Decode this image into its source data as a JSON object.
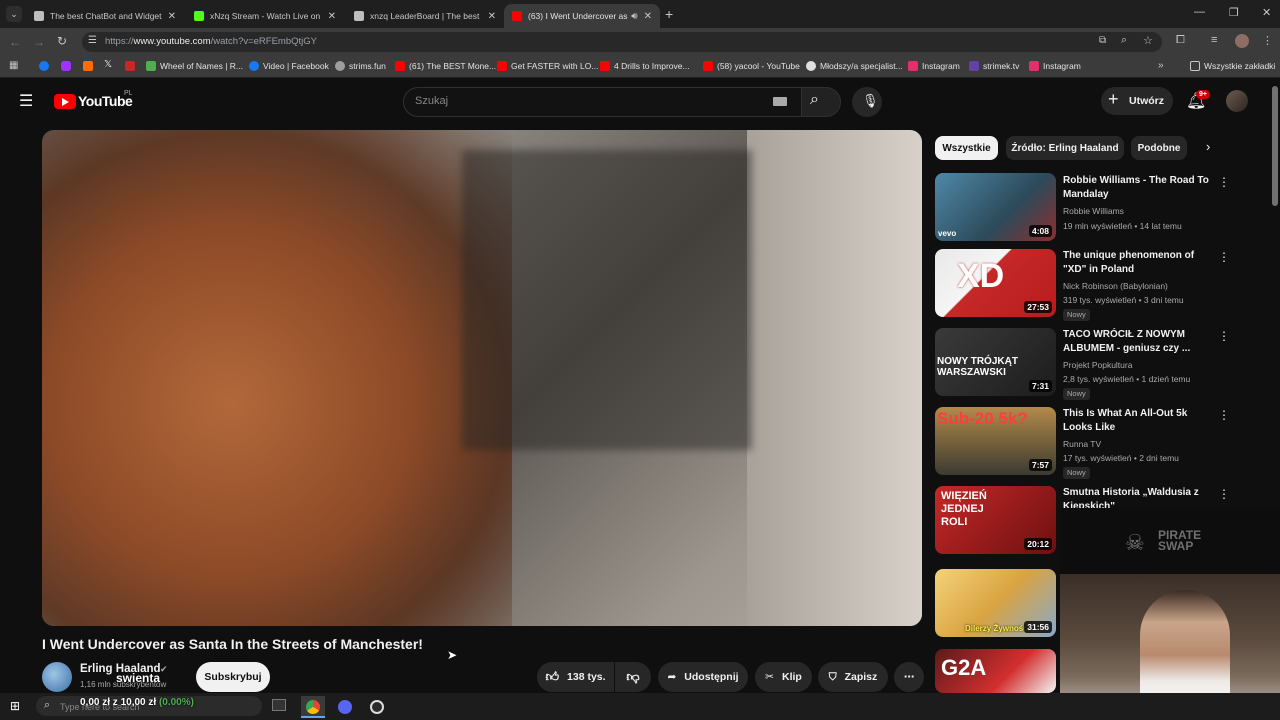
{
  "browser": {
    "tabs": [
      {
        "title": "The best ChatBot and Widgets",
        "active": false,
        "favicon_color": "#bdbdbd"
      },
      {
        "title": "xNzq Stream - Watch Live on K",
        "active": false,
        "favicon_color": "#53fc18"
      },
      {
        "title": "xnzq LeaderBoard | The best Ch",
        "active": false,
        "favicon_color": "#bdbdbd"
      },
      {
        "title": "(63) I Went Undercover as S",
        "active": true,
        "favicon_color": "#ff0000"
      }
    ],
    "url_prefix": "https://",
    "url_host": "www.youtube.com",
    "url_path": "/watch?v=eRFEmbQtjGY",
    "bookmarks": [
      {
        "label": "Wheel of Names | R...",
        "color": "#4caf50"
      },
      {
        "label": "Video | Facebook",
        "color": "#1877f2"
      },
      {
        "label": "strims.fun",
        "color": "#9e9e9e"
      },
      {
        "label": "(61) The BEST Mone...",
        "color": "#ff0000"
      },
      {
        "label": "Get FASTER with LO...",
        "color": "#ff0000"
      },
      {
        "label": "4 Drills to Improve...",
        "color": "#ff0000"
      },
      {
        "label": "(58) yacool - YouTube",
        "color": "#ff0000"
      },
      {
        "label": "Młodszy/a specjalist...",
        "color": "#e0e0e0"
      },
      {
        "label": "Instagram",
        "color": "#e1306c"
      },
      {
        "label": "strimek.tv",
        "color": "#6441a5"
      },
      {
        "label": "Instagram",
        "color": "#e1306c"
      }
    ],
    "all_bookmarks_label": "Wszystkie zakładki"
  },
  "youtube": {
    "logo_text": "YouTube",
    "region": "PL",
    "search_placeholder": "Szukaj",
    "create_label": "Utwórz",
    "notifications_badge": "9+",
    "video_title": "I Went Undercover as Santa In the Streets of Manchester!",
    "channel_name": "Erling Haaland",
    "subscribers": "1,16 mln subskrybentów",
    "subscribe_label": "Subskrybuj",
    "likes": "138 tys.",
    "share_label": "Udostępnij",
    "clip_label": "Klip",
    "save_label": "Zapisz",
    "chips": [
      "Wszystkie",
      "Źródło: Erling Haaland",
      "Podobne"
    ],
    "recommended": [
      {
        "title": "Robbie Williams - The Road To Mandalay",
        "channel": "Robbie Williams",
        "stats": "19 mln wyświetleń • 14 lat temu",
        "duration": "4:08",
        "badge": "",
        "thumb_color": "#3a6b8c",
        "thumb_text": "vevo"
      },
      {
        "title": "The unique phenomenon of \"XD\" in Poland",
        "channel": "Nick Robinson (Babylonian)",
        "stats": "319 tys. wyświetleń • 3 dni temu",
        "duration": "27:53",
        "badge": "Nowy",
        "thumb_color": "#c62828",
        "thumb_text": "XD"
      },
      {
        "title": "TACO WRÓCIŁ Z NOWYM ALBUMEM - geniusz czy ...",
        "channel": "Projekt Popkultura",
        "stats": "2,8 tys. wyświetleń • 1 dzień temu",
        "duration": "7:31",
        "badge": "Nowy",
        "thumb_color": "#2a2a2a",
        "thumb_text": "NOWY TRÓJKĄT WARSZAWSKI"
      },
      {
        "title": "This Is What An All-Out 5k Looks Like",
        "channel": "Runna TV",
        "stats": "17 tys. wyświetleń • 2 dni temu",
        "duration": "7:57",
        "badge": "Nowy",
        "thumb_color": "#8a6f3a",
        "thumb_text": "Sub-20 5k?"
      },
      {
        "title": "Smutna Historia „Waldusia z Kiepskich\"",
        "channel": "",
        "stats": "",
        "duration": "20:12",
        "badge": "",
        "thumb_color": "#8b1a1a",
        "thumb_text": "WIĘZIEŃ JEDNEJ ROLI"
      },
      {
        "title": "",
        "channel": "",
        "stats": "",
        "duration": "31:56",
        "badge": "",
        "thumb_color": "#d9a441",
        "thumb_text": "Dilerzy Żywności"
      },
      {
        "title": "",
        "channel": "",
        "stats": "",
        "duration": "",
        "badge": "",
        "thumb_color": "#7a1f1f",
        "thumb_text": "G2A"
      }
    ]
  },
  "overlay": {
    "sponsor_text": "PIRATE SWAP",
    "stream_username": "swienta",
    "balance_text": "0,00 zł z 10,00 zł",
    "balance_percent": "(0.00%)"
  },
  "taskbar": {
    "search_placeholder": "Type here to search"
  }
}
